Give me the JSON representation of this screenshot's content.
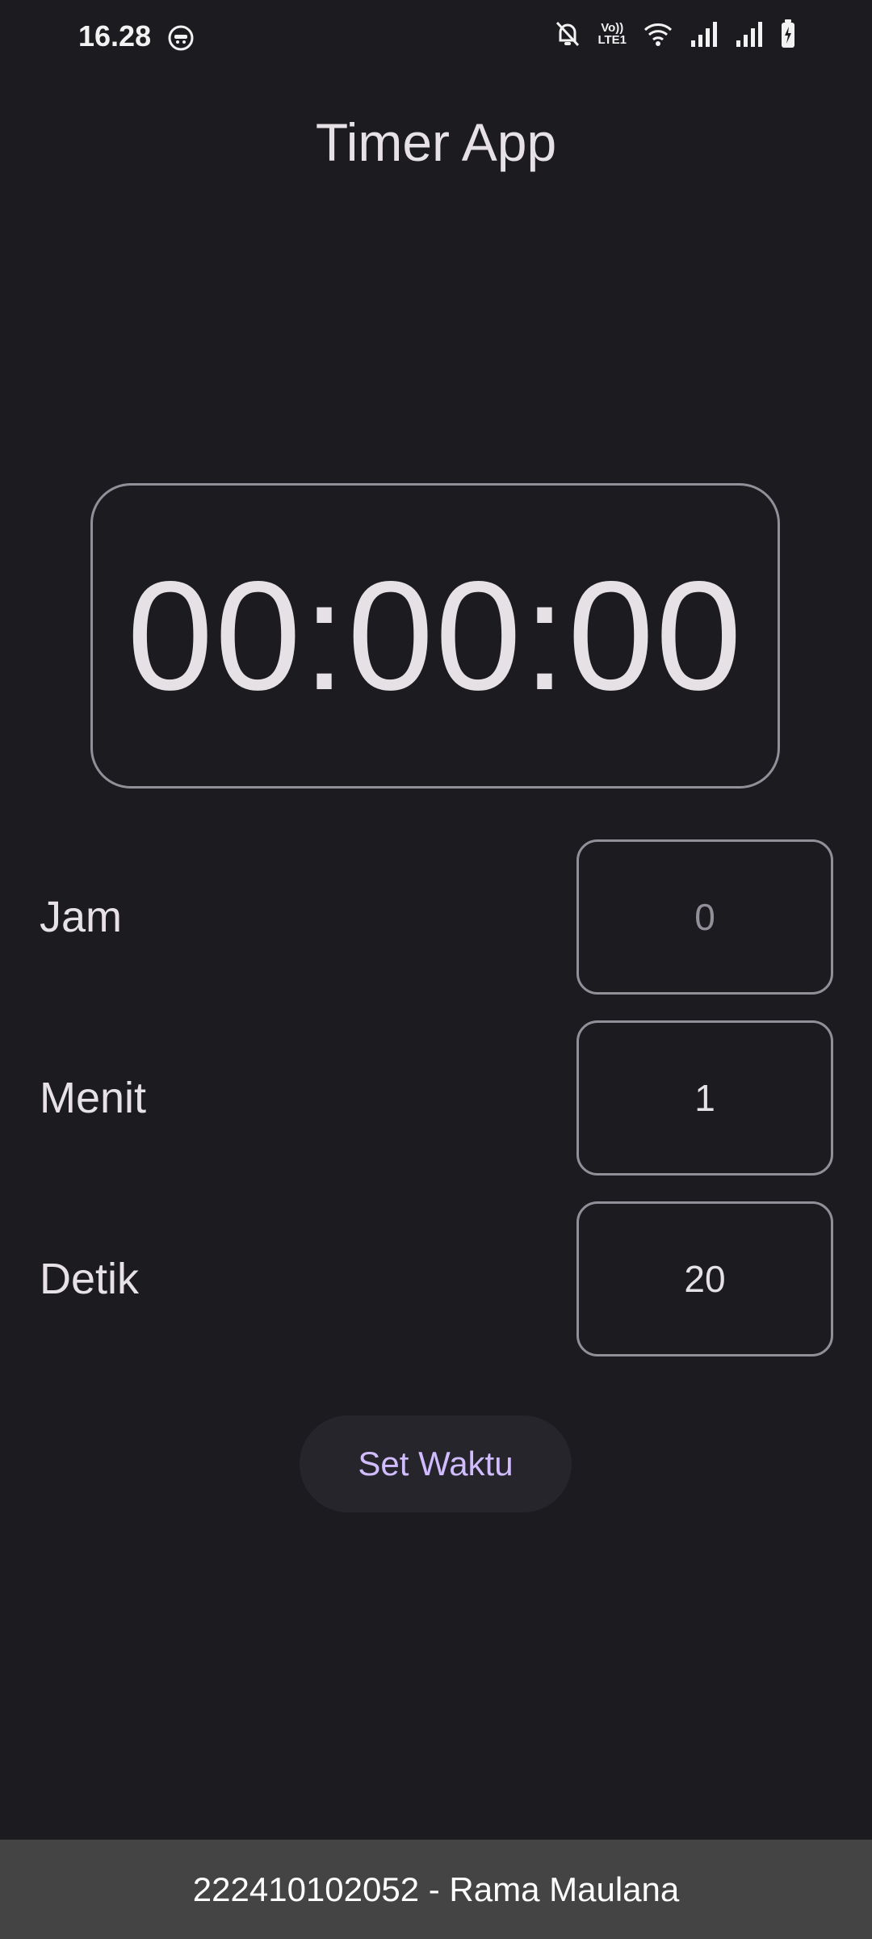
{
  "status_bar": {
    "time": "16.28",
    "icons": [
      "face-notification-icon",
      "bell-off-icon",
      "volte-icon",
      "wifi-icon",
      "signal-1-icon",
      "signal-2-icon",
      "battery-charging-icon"
    ],
    "volte_label_top": "Vo))",
    "volte_label_bottom": "LTE1"
  },
  "app": {
    "title": "Timer App"
  },
  "timer": {
    "display": "00:00:00"
  },
  "fields": [
    {
      "label": "Jam",
      "value": "",
      "placeholder": "0"
    },
    {
      "label": "Menit",
      "value": "1",
      "placeholder": ""
    },
    {
      "label": "Detik",
      "value": "20",
      "placeholder": ""
    }
  ],
  "actions": {
    "set_label": "Set Waktu"
  },
  "footer": {
    "text": "222410102052 - Rama Maulana"
  },
  "colors": {
    "background": "#1c1b20",
    "text": "#e6e1e5",
    "outline": "#938f99",
    "accent": "#d0bcff",
    "button_bg": "#27252c",
    "footer_bg": "#444444"
  }
}
